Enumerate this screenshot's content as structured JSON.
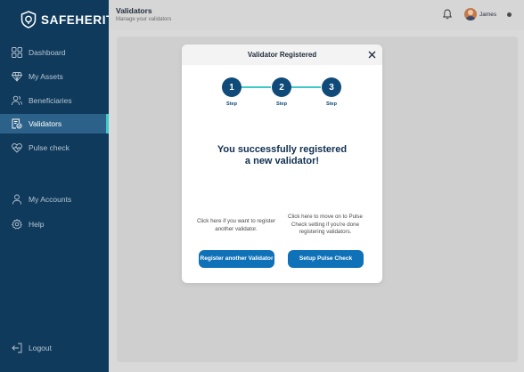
{
  "brand": {
    "name": "SAFEHERIT"
  },
  "sidebar": {
    "items": [
      {
        "label": "Dashboard",
        "icon": "grid-icon"
      },
      {
        "label": "My Assets",
        "icon": "diamond-icon"
      },
      {
        "label": "Beneficiaries",
        "icon": "users-icon"
      },
      {
        "label": "Validators",
        "icon": "validator-icon",
        "active": true
      },
      {
        "label": "Pulse check",
        "icon": "heart-pulse-icon"
      },
      {
        "label": "My Accounts",
        "icon": "user-icon"
      },
      {
        "label": "Help",
        "icon": "gear-icon"
      },
      {
        "label": "Logout",
        "icon": "logout-icon"
      }
    ]
  },
  "header": {
    "title": "Validators",
    "subtitle": "Manage your validators",
    "user_name": "James"
  },
  "modal": {
    "title": "Validator Registered",
    "steps": [
      {
        "number": "1",
        "label": "Step"
      },
      {
        "number": "2",
        "label": "Step"
      },
      {
        "number": "3",
        "label": "Step"
      }
    ],
    "success_line1": "You successfully registered",
    "success_line2": "a new validator!",
    "left_text": "Click here if you want to register another validator.",
    "right_text": "Click here to move on to Pulse Check setting if you're done registering validators.",
    "left_button": "Register another Validator",
    "right_button": "Setup Pulse Check"
  },
  "colors": {
    "sidebar_bg": "#0f3a5c",
    "active_item_bg": "#2c6189",
    "accent_teal": "#3ec9c9",
    "step_circle": "#0f4a78",
    "button_blue": "#0f71b8"
  }
}
